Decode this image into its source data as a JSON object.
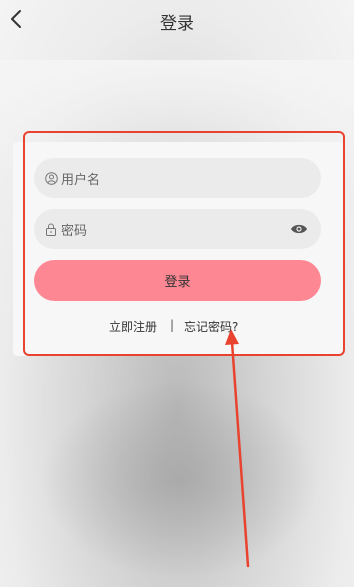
{
  "header": {
    "title": "登录",
    "back_icon": "chevron-left-icon"
  },
  "form": {
    "username_placeholder": "用户名",
    "username_icon": "user-icon",
    "password_placeholder": "密码",
    "password_icon": "lock-icon",
    "visibility_icon": "eye-icon",
    "login_label": "登录",
    "login_color": "#fd8894"
  },
  "links": {
    "register": "立即注册",
    "separator": "|",
    "forgot": "忘记密码?"
  },
  "annotation": {
    "color": "#e94330"
  }
}
